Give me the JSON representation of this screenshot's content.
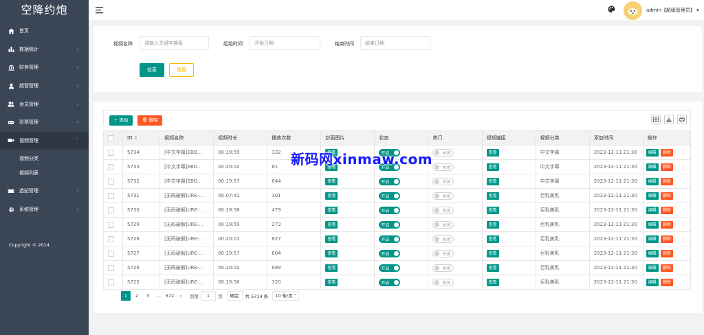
{
  "app": {
    "title": "空降约炮"
  },
  "sidebar": {
    "items": [
      {
        "label": "首页",
        "icon": "home-icon"
      },
      {
        "label": "数据统计",
        "icon": "bar-chart-icon"
      },
      {
        "label": "财务管理",
        "icon": "bank-icon"
      },
      {
        "label": "超管管理",
        "icon": "user-icon"
      },
      {
        "label": "会员管理",
        "icon": "users-icon"
      },
      {
        "label": "彩票管理",
        "icon": "gamepad-icon"
      },
      {
        "label": "视频管理",
        "icon": "video-icon"
      }
    ],
    "subitems": [
      "视频分类",
      "视频列表"
    ],
    "items_after": [
      {
        "label": "选妃管理",
        "icon": "ticket-icon"
      },
      {
        "label": "系统管理",
        "icon": "gear-icon"
      }
    ],
    "copyright": "Copyright © 2014"
  },
  "header": {
    "user": "admin【超级管理员】",
    "caret": "▾"
  },
  "search": {
    "name_label": "视频名称",
    "name_placeholder": "请输入关键字搜索",
    "start_label": "起始时间",
    "start_placeholder": "开始日期",
    "end_label": "结束时间",
    "end_placeholder": "结束日期",
    "search_btn": "检索",
    "reset_btn": "重置"
  },
  "toolbar": {
    "add": "+ 添加",
    "delete": "删除"
  },
  "table": {
    "headers": [
      "ID",
      "视频名称",
      "视频时长",
      "播放次数",
      "封面图片",
      "状态",
      "热门",
      "视频链接",
      "视频分类",
      "添加时间",
      "操作"
    ],
    "view_label": "查看",
    "on_label": "开启",
    "off_label": "关闭",
    "edit_label": "编辑",
    "delete_label": "删除",
    "rows": [
      {
        "id": "5734",
        "name": "[中文字幕]EBO...",
        "duration": "00:19:59",
        "plays": "332",
        "category": "中文字幕",
        "added": "2023-12-11 21:30"
      },
      {
        "id": "5733",
        "name": "[中文字幕]EBO...",
        "duration": "00:20:02",
        "plays": "61",
        "category": "中文字幕",
        "added": "2023-12-11 21:30"
      },
      {
        "id": "5732",
        "name": "[中文字幕]EBO...",
        "duration": "00:19:57",
        "plays": "644",
        "category": "中文字幕",
        "added": "2023-12-11 21:30"
      },
      {
        "id": "5731",
        "name": "[无码破解]URE-...",
        "duration": "00:07:41",
        "plays": "301",
        "category": "巨乳美乳",
        "added": "2023-12-11 21:30"
      },
      {
        "id": "5730",
        "name": "[无码破解]URE-...",
        "duration": "00:19:58",
        "plays": "479",
        "category": "巨乳美乳",
        "added": "2023-12-11 21:30"
      },
      {
        "id": "5729",
        "name": "[无码破解]URE-...",
        "duration": "00:19:59",
        "plays": "273",
        "category": "巨乳美乳",
        "added": "2023-12-11 21:30"
      },
      {
        "id": "5728",
        "name": "[无码破解]URE-...",
        "duration": "00:20:01",
        "plays": "827",
        "category": "巨乳美乳",
        "added": "2023-12-11 21:30"
      },
      {
        "id": "5727",
        "name": "[无码破解]URE-...",
        "duration": "00:19:57",
        "plays": "604",
        "category": "巨乳美乳",
        "added": "2023-12-11 21:30"
      },
      {
        "id": "5726",
        "name": "[无码破解]URE-...",
        "duration": "00:20:02",
        "plays": "699",
        "category": "巨乳美乳",
        "added": "2023-12-11 21:30"
      },
      {
        "id": "5725",
        "name": "[无码破解]URE-...",
        "duration": "00:19:56",
        "plays": "320",
        "category": "巨乳美乳",
        "added": "2023-12-11 21:30"
      }
    ]
  },
  "pagination": {
    "prev": "‹",
    "pages": [
      "1",
      "2",
      "3",
      "...",
      "572"
    ],
    "current": "1",
    "next": "›",
    "goto_label": "到第",
    "goto_value": "1",
    "page_unit": "页",
    "confirm": "确定",
    "total": "共 5714 条",
    "per_page": "10 条/页"
  },
  "watermark": "新码网xinmaw.com",
  "colors": {
    "primary": "#009688",
    "danger": "#ff5722",
    "warning": "#ffb800",
    "sidebar": "#3a4556"
  }
}
